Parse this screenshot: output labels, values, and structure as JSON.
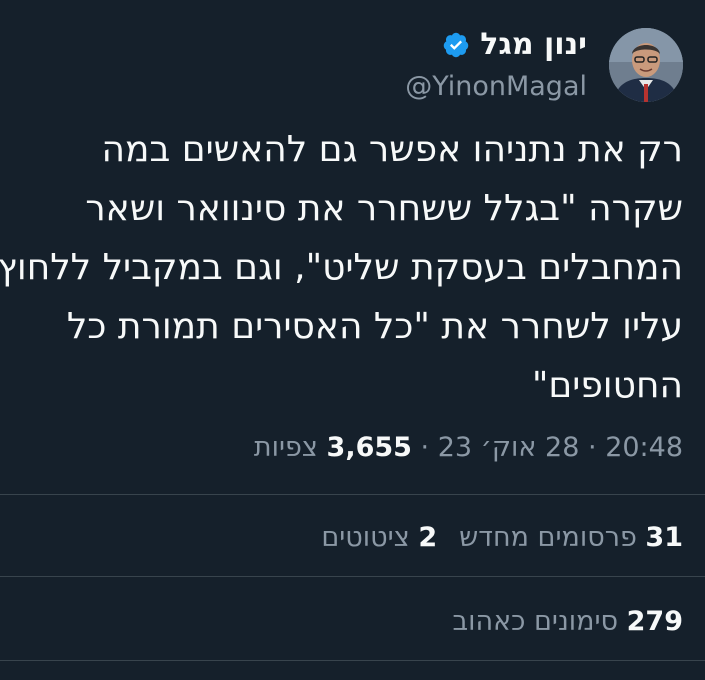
{
  "author": {
    "display_name": "ינון מגל",
    "handle": "@YinonMagal",
    "verified": true,
    "avatar_icon": "profile-photo"
  },
  "tweet": {
    "lines": [
      "רק את נתניהו אפשר גם להאשים במה",
      "שקרה \"בגלל ששחרר את סינוואר ושאר",
      "המחבלים בעסקת שליט\", וגם במקביל ללחוץ",
      "עליו לשחרר את \"כל האסירים תמורת כל",
      "החטופים\""
    ]
  },
  "meta": {
    "time": "20:48",
    "separator": "·",
    "date": "28 אוק׳ 23",
    "views_count": "3,655",
    "views_label": "צפיות"
  },
  "stats": {
    "retweets_count": "31",
    "retweets_label": "פרסומים מחדש",
    "quotes_count": "2",
    "quotes_label": "ציטוטים",
    "likes_count": "279",
    "likes_label": "סימונים כאהוב"
  },
  "colors": {
    "background": "#15202b",
    "text": "#f7f9f9",
    "secondary": "#8b98a5",
    "verified": "#1d9bf0",
    "divider": "#38444d"
  }
}
